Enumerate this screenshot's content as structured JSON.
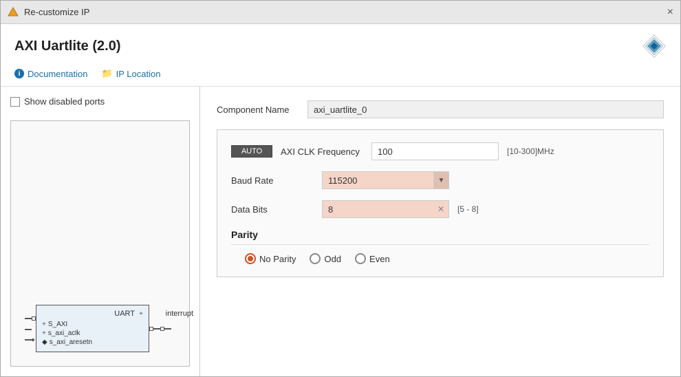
{
  "window": {
    "title": "Re-customize IP",
    "close_label": "×"
  },
  "header": {
    "app_title": "AXI Uartlite (2.0)",
    "nav": {
      "documentation": "Documentation",
      "ip_location": "IP Location"
    }
  },
  "left_panel": {
    "show_ports_label": "Show disabled ports"
  },
  "block": {
    "s_axi": "S_AXI",
    "s_axi_aclk": "s_axi_aclk",
    "s_axi_aresetn": "s_axi_aresetn",
    "uart_label": "UART",
    "interrupt_label": "interrupt"
  },
  "form": {
    "component_name_label": "Component Name",
    "component_name_value": "axi_uartlite_0"
  },
  "config": {
    "auto_label": "AUTO",
    "axi_clk_label": "AXI CLK Frequency",
    "axi_clk_value": "100",
    "axi_clk_unit": "[10-300]MHz",
    "baud_rate_label": "Baud Rate",
    "baud_rate_value": "115200",
    "data_bits_label": "Data Bits",
    "data_bits_value": "8",
    "data_bits_range": "[5 - 8]"
  },
  "parity": {
    "title": "Parity",
    "options": [
      {
        "label": "No Parity",
        "selected": true
      },
      {
        "label": "Odd",
        "selected": false
      },
      {
        "label": "Even",
        "selected": false
      }
    ]
  }
}
